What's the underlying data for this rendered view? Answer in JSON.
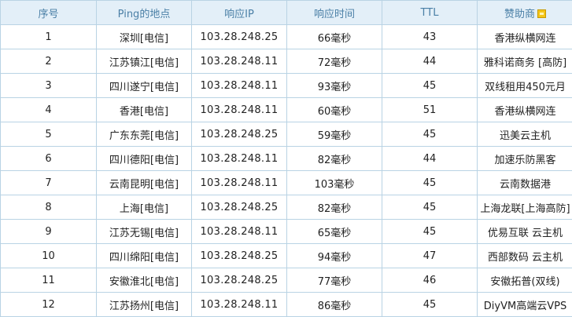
{
  "table": {
    "headers": {
      "index": "序号",
      "location": "Ping的地点",
      "ip": "响应IP",
      "time": "响应时间",
      "ttl": "TTL",
      "sponsor": "赞助商"
    },
    "sponsor_header_icon": "info-icon",
    "rows": [
      {
        "index": "1",
        "location": "深圳[电信]",
        "ip": "103.28.248.25",
        "time": "66毫秒",
        "ttl": "43",
        "sponsor": "香港纵横网连"
      },
      {
        "index": "2",
        "location": "江苏镇江[电信]",
        "ip": "103.28.248.11",
        "time": "72毫秒",
        "ttl": "44",
        "sponsor": "雅科诺商务 [高防]"
      },
      {
        "index": "3",
        "location": "四川遂宁[电信]",
        "ip": "103.28.248.11",
        "time": "93毫秒",
        "ttl": "45",
        "sponsor": "双线租用450元月"
      },
      {
        "index": "4",
        "location": "香港[电信]",
        "ip": "103.28.248.11",
        "time": "60毫秒",
        "ttl": "51",
        "sponsor": "香港纵横网连"
      },
      {
        "index": "5",
        "location": "广东东莞[电信]",
        "ip": "103.28.248.25",
        "time": "59毫秒",
        "ttl": "45",
        "sponsor": "迅美云主机"
      },
      {
        "index": "6",
        "location": "四川德阳[电信]",
        "ip": "103.28.248.11",
        "time": "82毫秒",
        "ttl": "44",
        "sponsor": "加速乐防黑客"
      },
      {
        "index": "7",
        "location": "云南昆明[电信]",
        "ip": "103.28.248.11",
        "time": "103毫秒",
        "ttl": "45",
        "sponsor": "云南数据港"
      },
      {
        "index": "8",
        "location": "上海[电信]",
        "ip": "103.28.248.25",
        "time": "82毫秒",
        "ttl": "45",
        "sponsor": "上海龙联[上海高防]"
      },
      {
        "index": "9",
        "location": "江苏无锡[电信]",
        "ip": "103.28.248.11",
        "time": "65毫秒",
        "ttl": "45",
        "sponsor": "优易互联 云主机"
      },
      {
        "index": "10",
        "location": "四川绵阳[电信]",
        "ip": "103.28.248.25",
        "time": "94毫秒",
        "ttl": "47",
        "sponsor": "西部数码 云主机"
      },
      {
        "index": "11",
        "location": "安徽淮北[电信]",
        "ip": "103.28.248.25",
        "time": "77毫秒",
        "ttl": "46",
        "sponsor": "安徽拓普(双线)"
      },
      {
        "index": "12",
        "location": "江苏扬州[电信]",
        "ip": "103.28.248.11",
        "time": "86毫秒",
        "ttl": "45",
        "sponsor": "DiyVM高端云VPS"
      }
    ]
  }
}
